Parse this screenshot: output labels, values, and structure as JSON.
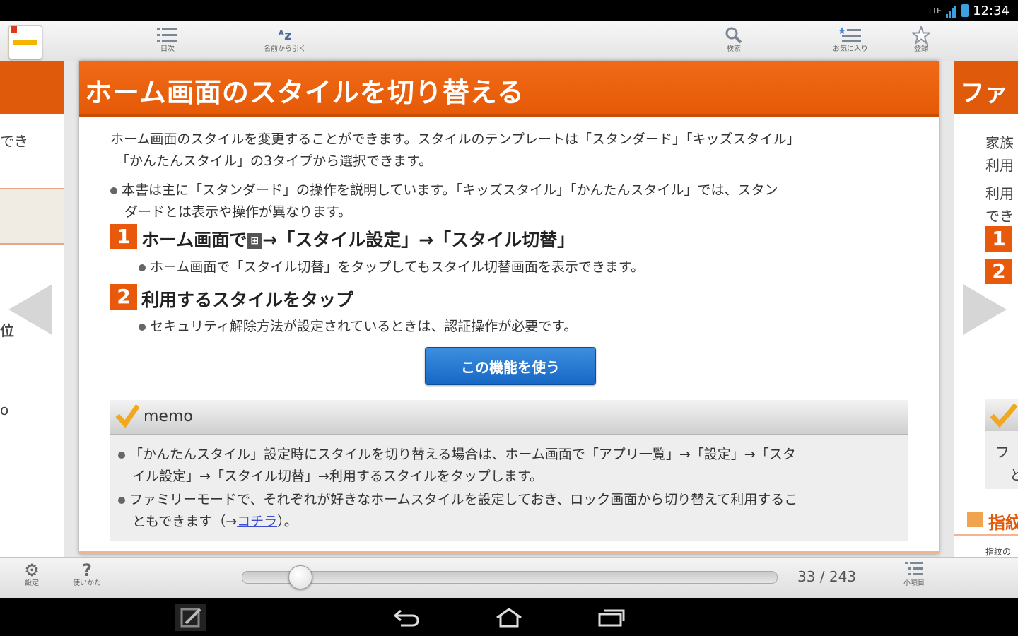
{
  "status_bar": {
    "network": "LTE",
    "time": "12:34"
  },
  "toolbar": {
    "contents_label": "目次",
    "index_label": "名前から引く",
    "search_label": "検索",
    "favorites_label": "お気に入り",
    "bookmark_label": "登録"
  },
  "left_page": {
    "line1": "でき",
    "line2": "位",
    "line3": "o"
  },
  "right_page": {
    "title": "ファ",
    "line1": "家族",
    "line2": "利用",
    "line3": "利用",
    "line4": "でき",
    "step1": "1",
    "step2": "2",
    "bullet": "フ",
    "bullet2": "と",
    "section": "指紋",
    "small": "指紋の"
  },
  "page": {
    "title": "ホーム画面のスタイルを切り替える",
    "intro_line1": "ホーム画面のスタイルを変更することができます。スタイルのテンプレートは「スタンダード」「キッズスタイル」",
    "intro_line2": "「かんたんスタイル」の3タイプから選択できます。",
    "note_line1": "本書は主に「スタンダード」の操作を説明しています。「キッズスタイル」「かんたんスタイル」では、スタン",
    "note_line2": "ダードとは表示や操作が異なります。",
    "step1_number": "1",
    "step1_prefix": "ホーム画面で",
    "step1_suffix": "→「スタイル設定」→「スタイル切替」",
    "step1_note": "ホーム画面で「スタイル切替」をタップしてもスタイル切替画面を表示できます。",
    "step2_number": "2",
    "step2_text": "利用するスタイルをタップ",
    "step2_note": "セキュリティ解除方法が設定されているときは、認証操作が必要です。",
    "use_button": "この機能を使う",
    "memo_label": "memo",
    "memo1_line1": "「かんたんスタイル」設定時にスタイルを切り替える場合は、ホーム画面で「アプリ一覧」→「設定」→「スタ",
    "memo1_line2": "イル設定」→「スタイル切替」→利用するスタイルをタップします。",
    "memo2_line1": "ファミリーモードで、それぞれが好きなホームスタイルを設定しておき、ロック画面から切り替えて利用するこ",
    "memo2_line2_prefix": "ともできます（→",
    "memo2_link": "コチラ",
    "memo2_line2_suffix": "）。"
  },
  "bottom_bar": {
    "settings_label": "設定",
    "help_label": "使いかた",
    "page_counter": "33 / 243",
    "subitems_label": "小項目",
    "slider_position": 0.11
  },
  "colors": {
    "accent": "#e8590c",
    "button": "#1f73cf",
    "link": "#3b4fd0"
  },
  "icons": [
    "list-icon",
    "az-sort-icon",
    "search-icon",
    "favorites-list-icon",
    "star-icon",
    "gear-icon",
    "help-icon",
    "back-icon",
    "home-icon",
    "recents-icon",
    "edit-icon"
  ]
}
